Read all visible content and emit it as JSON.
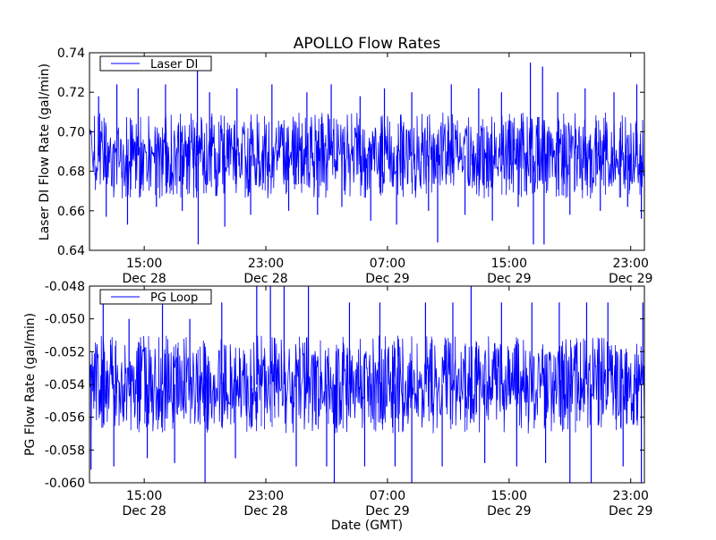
{
  "chart_data": [
    {
      "type": "line",
      "title": "APOLLO Flow Rates",
      "xlabel": "",
      "ylabel": "Laser DI Flow Rate (gal/min)",
      "x_units": "hours since Dec 28 00:00 GMT",
      "xlim": [
        11.4,
        47.9
      ],
      "ylim": [
        0.64,
        0.74
      ],
      "yticks": [
        0.64,
        0.66,
        0.68,
        0.7,
        0.72,
        0.74
      ],
      "ytick_labels": [
        "0.64",
        "0.66",
        "0.68",
        "0.70",
        "0.72",
        "0.74"
      ],
      "xticks": [
        15,
        23,
        31,
        39,
        47
      ],
      "xtick_labels": [
        [
          "15:00",
          "Dec 28"
        ],
        [
          "23:00",
          "Dec 28"
        ],
        [
          "07:00",
          "Dec 29"
        ],
        [
          "15:00",
          "Dec 29"
        ],
        [
          "23:00",
          "Dec 29"
        ]
      ],
      "legend": {
        "label": "Laser DI",
        "placement": "top-left"
      },
      "color": "#0000ff",
      "band": [
        0.672,
        0.704
      ],
      "spikes": [
        [
          12.0,
          0.718
        ],
        [
          12.5,
          0.657
        ],
        [
          13.2,
          0.724
        ],
        [
          13.9,
          0.653
        ],
        [
          14.6,
          0.722
        ],
        [
          15.8,
          0.662
        ],
        [
          16.4,
          0.724
        ],
        [
          17.5,
          0.66
        ],
        [
          18.5,
          0.732
        ],
        [
          18.55,
          0.643
        ],
        [
          19.3,
          0.72
        ],
        [
          20.3,
          0.652
        ],
        [
          21.1,
          0.722
        ],
        [
          22.0,
          0.658
        ],
        [
          23.4,
          0.724
        ],
        [
          24.5,
          0.66
        ],
        [
          25.7,
          0.72
        ],
        [
          26.4,
          0.658
        ],
        [
          27.3,
          0.724
        ],
        [
          28.0,
          0.662
        ],
        [
          29.2,
          0.718
        ],
        [
          29.9,
          0.655
        ],
        [
          30.8,
          0.722
        ],
        [
          31.6,
          0.653
        ],
        [
          32.6,
          0.72
        ],
        [
          33.7,
          0.66
        ],
        [
          34.3,
          0.644
        ],
        [
          35.2,
          0.724
        ],
        [
          36.1,
          0.658
        ],
        [
          37.0,
          0.722
        ],
        [
          37.9,
          0.655
        ],
        [
          38.5,
          0.72
        ],
        [
          39.6,
          0.662
        ],
        [
          40.4,
          0.735
        ],
        [
          40.6,
          0.643
        ],
        [
          41.2,
          0.733
        ],
        [
          41.3,
          0.643
        ],
        [
          42.2,
          0.72
        ],
        [
          43.0,
          0.658
        ],
        [
          44.0,
          0.722
        ],
        [
          45.0,
          0.66
        ],
        [
          45.9,
          0.72
        ],
        [
          46.8,
          0.662
        ],
        [
          47.4,
          0.724
        ],
        [
          47.7,
          0.656
        ]
      ]
    },
    {
      "type": "line",
      "title": "",
      "xlabel": "Date (GMT)",
      "ylabel": "PG Flow Rate (gal/min)",
      "x_units": "hours since Dec 28 00:00 GMT",
      "xlim": [
        11.4,
        47.9
      ],
      "ylim": [
        -0.06,
        -0.048
      ],
      "yticks": [
        -0.06,
        -0.058,
        -0.056,
        -0.054,
        -0.052,
        -0.05,
        -0.048
      ],
      "ytick_labels": [
        "-0.060",
        "-0.058",
        "-0.056",
        "-0.054",
        "-0.052",
        "-0.050",
        "-0.048"
      ],
      "xticks": [
        15,
        23,
        31,
        39,
        47
      ],
      "xtick_labels": [
        [
          "15:00",
          "Dec 28"
        ],
        [
          "23:00",
          "Dec 28"
        ],
        [
          "07:00",
          "Dec 29"
        ],
        [
          "15:00",
          "Dec 29"
        ],
        [
          "23:00",
          "Dec 29"
        ]
      ],
      "legend": {
        "label": "PG Loop",
        "placement": "top-left"
      },
      "color": "#0000ff",
      "band": [
        -0.0562,
        -0.0518
      ],
      "spikes": [
        [
          11.5,
          -0.0592
        ],
        [
          12.3,
          -0.049
        ],
        [
          13.0,
          -0.059
        ],
        [
          14.0,
          -0.05
        ],
        [
          15.2,
          -0.0585
        ],
        [
          16.2,
          -0.049
        ],
        [
          17.0,
          -0.0588
        ],
        [
          18.0,
          -0.05
        ],
        [
          19.0,
          -0.06
        ],
        [
          20.1,
          -0.049
        ],
        [
          21.0,
          -0.0585
        ],
        [
          22.4,
          -0.048
        ],
        [
          23.3,
          -0.048
        ],
        [
          24.2,
          -0.048
        ],
        [
          25.0,
          -0.059
        ],
        [
          25.8,
          -0.048
        ],
        [
          27.0,
          -0.059
        ],
        [
          27.5,
          -0.06
        ],
        [
          28.5,
          -0.049
        ],
        [
          29.5,
          -0.059
        ],
        [
          30.5,
          -0.049
        ],
        [
          31.5,
          -0.059
        ],
        [
          32.6,
          -0.06
        ],
        [
          33.5,
          -0.049
        ],
        [
          34.6,
          -0.059
        ],
        [
          35.3,
          -0.049
        ],
        [
          36.5,
          -0.048
        ],
        [
          37.4,
          -0.0588
        ],
        [
          38.5,
          -0.049
        ],
        [
          39.5,
          -0.059
        ],
        [
          40.5,
          -0.049
        ],
        [
          41.4,
          -0.0588
        ],
        [
          42.3,
          -0.049
        ],
        [
          43.0,
          -0.06
        ],
        [
          44.1,
          -0.049
        ],
        [
          44.4,
          -0.06
        ],
        [
          45.5,
          -0.049
        ],
        [
          46.5,
          -0.059
        ],
        [
          47.7,
          -0.06
        ],
        [
          47.8,
          -0.049
        ]
      ]
    }
  ]
}
